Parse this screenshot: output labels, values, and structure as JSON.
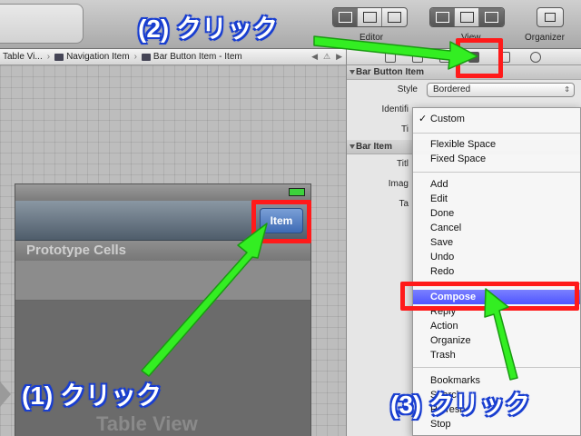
{
  "toolbar": {
    "editor_label": "Editor",
    "view_label": "View",
    "organizer_label": "Organizer"
  },
  "jumpbar": {
    "crumbs": [
      "Table Vi...",
      "Navigation Item",
      "Bar Button Item - Item"
    ]
  },
  "canvas": {
    "item_button": "Item",
    "prototype_cells": "Prototype Cells",
    "table_view": "Table View"
  },
  "inspector": {
    "sections": {
      "bar_button_item": "Bar Button Item",
      "bar_item": "Bar Item"
    },
    "style_label": "Style",
    "style_value": "Bordered",
    "identifier_label": "Identifi",
    "title_label": "Ti",
    "bar_title_label": "Titl",
    "image_label": "Imag",
    "tag_label": "Ta"
  },
  "menu": {
    "checked": "Custom",
    "group1": [
      "Flexible Space",
      "Fixed Space"
    ],
    "group2": [
      "Add",
      "Edit",
      "Done",
      "Cancel",
      "Save",
      "Undo",
      "Redo"
    ],
    "highlighted": "Compose",
    "group3_after": [
      "Reply",
      "Action",
      "Organize",
      "Trash"
    ],
    "group4": [
      "Bookmarks",
      "Search",
      "Refresh",
      "Stop"
    ]
  },
  "annotations": {
    "step1": "(1) クリック",
    "step2": "(2) クリック",
    "step3": "(3) クリック"
  },
  "colors": {
    "annotation_red": "#ff1a1a",
    "arrow_green": "#33ee22",
    "highlight": "#5b60ff"
  }
}
